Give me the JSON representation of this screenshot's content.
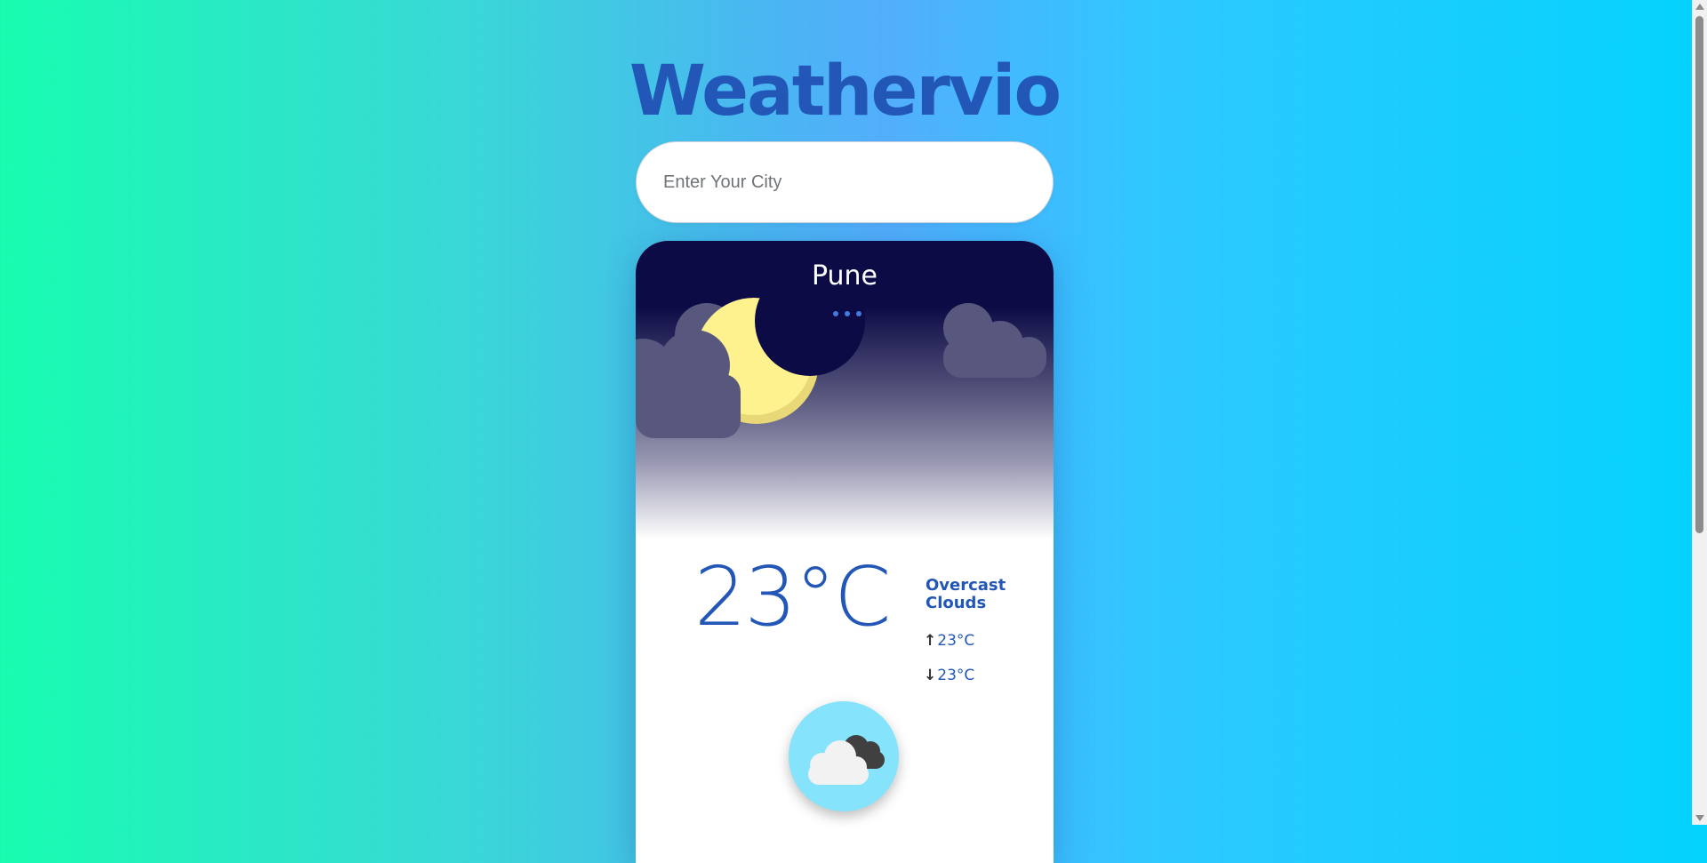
{
  "app": {
    "title": "Weathervio"
  },
  "search": {
    "placeholder": "Enter Your City",
    "value": ""
  },
  "weather": {
    "city": "Pune",
    "temperature": "23°C",
    "description": "Overcast Clouds",
    "high": "23°C",
    "low": "23°C",
    "high_arrow": "↑",
    "low_arrow": "↓",
    "scene_icon": "night-moon-clouds-icon",
    "condition_icon": "overcast-clouds-icon"
  },
  "colors": {
    "accent": "#2257b8",
    "night_sky": "#0d0b45",
    "moon": "#fef28f",
    "badge": "#85e4fb"
  }
}
